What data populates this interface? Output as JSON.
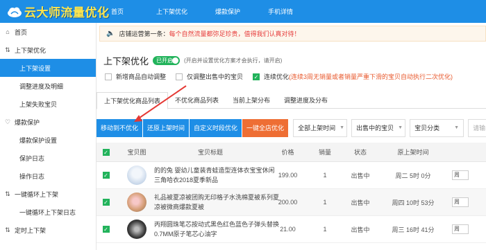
{
  "brand": {
    "name": "云大师流量优化"
  },
  "topnav": [
    "首页",
    "上下架优化",
    "爆款保护",
    "手机详情"
  ],
  "sidebar": {
    "home": "首页",
    "g1": "上下架优化",
    "g1_items": [
      "上下架设置",
      "调整进度及明细",
      "上架失败宝贝"
    ],
    "g2": "爆款保护",
    "g2_items": [
      "爆款保护设置",
      "保护日志",
      "操作日志"
    ],
    "g3": "一键循环上下架",
    "g3_items": [
      "一键循环上下架日志"
    ],
    "g4": "定时上下架"
  },
  "notice": {
    "label": "店铺运营第一条：",
    "message": "每个自然流量都弥足珍贵，值得我们认真对待！"
  },
  "page": {
    "title": "上下架优化",
    "toggle_label": "已开启",
    "hint": "(开启并设置优化方案才会执行，请开启)"
  },
  "options": {
    "o1": "新增商品自动调整",
    "o2": "仅调整出售中的宝贝",
    "o3_label": "连续优化",
    "o3_desc": "(连续3周无销量或者销量严重下滑的宝贝自动执行二次优化)"
  },
  "tabs": [
    "上下架优化商品列表",
    "不优化商品列表",
    "当前上架分布",
    "调整进度及分布"
  ],
  "toolbar": {
    "btn1": "移动到不优化",
    "btn2": "还原上架时间",
    "btn3": "自定义时段优化",
    "btn4": "一键全店优化",
    "sel1": "全部上架时间",
    "sel2": "出售中的宝贝",
    "sel3": "宝贝分类",
    "search_placeholder": "请输"
  },
  "table": {
    "headers": [
      "宝贝图",
      "宝贝标题",
      "价格",
      "销量",
      "状态",
      "原上架时间"
    ],
    "rows": [
      {
        "title": "的的兔 婴幼儿童装青蛙造型连体衣宝宝休闲三角哈衣2018夏季新品",
        "price": "199.00",
        "sales": "1",
        "status": "出售中",
        "time": "周二 5时 0分",
        "extra": "周"
      },
      {
        "title": "礼品被夏凉被团购无印格子水洗棉夏被系列夏凉被微商爆款夏被",
        "price": "200.00",
        "sales": "1",
        "status": "出售中",
        "time": "周四 10时 53分",
        "extra": "周"
      },
      {
        "title": "丙翔圆珠笔芯按动式黑色红色蓝色子弹头替换0.7MM原子笔芯心油字",
        "price": "21.00",
        "sales": "1",
        "status": "出售中",
        "time": "周三 16时 41分",
        "extra": "周"
      }
    ]
  }
}
